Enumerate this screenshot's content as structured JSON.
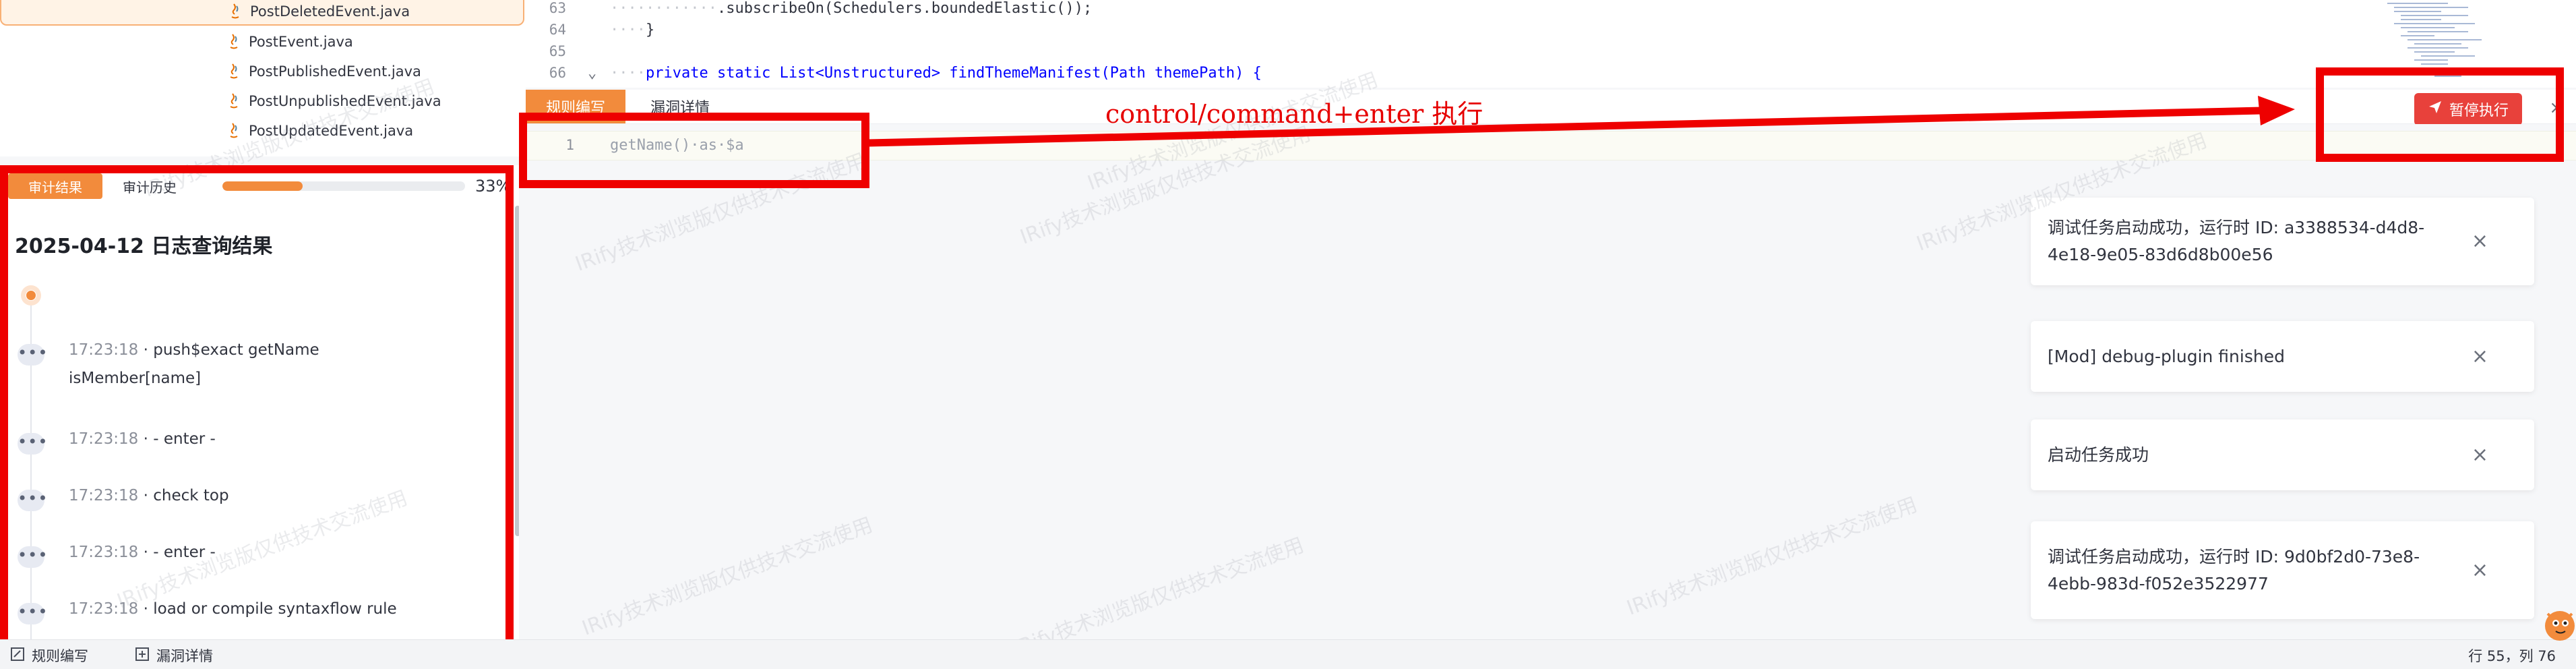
{
  "file_tree": {
    "items": [
      {
        "name": "PostDeletedEvent.java",
        "selected": true
      },
      {
        "name": "PostEvent.java",
        "selected": false
      },
      {
        "name": "PostPublishedEvent.java",
        "selected": false
      },
      {
        "name": "PostUnpublishedEvent.java",
        "selected": false
      },
      {
        "name": "PostUpdatedEvent.java",
        "selected": false
      }
    ]
  },
  "code_editor": {
    "lines": [
      {
        "no": "63",
        "ws": "············",
        "text": ".subscribeOn(Schedulers.boundedElastic());"
      },
      {
        "no": "64",
        "ws": "····",
        "text": "}"
      },
      {
        "no": "65",
        "ws": "",
        "text": ""
      },
      {
        "no": "66",
        "ws": "····",
        "text": "private static List<Unstructured> findThemeManifest(Path themePath) {"
      }
    ]
  },
  "rule_editor": {
    "tabs": [
      "规则编写",
      "漏洞详情"
    ],
    "line_no": "1",
    "rule_text": "getName()·as·$a",
    "pause_button": "暂停执行",
    "close_icon": "×"
  },
  "annotation": {
    "label": "control/command+enter 执行",
    "color": "#ee0000"
  },
  "audit_panel": {
    "tabs": [
      "审计结果",
      "审计历史"
    ],
    "progress": 0.33,
    "progress_label": "33%",
    "title": "2025-04-12 日志查询结果",
    "timeline": [
      {
        "time": "17:23:18",
        "message": "push$exact   getName isMember[name]"
      },
      {
        "time": "17:23:18",
        "message": "- enter -"
      },
      {
        "time": "17:23:18",
        "message": "check top"
      },
      {
        "time": "17:23:18",
        "message": "- enter -"
      },
      {
        "time": "17:23:18",
        "message": "load or compile syntaxflow rule"
      }
    ]
  },
  "notifications": [
    {
      "text": "调试任务启动成功，运行时 ID: a3388534-d4d8-4e18-9e05-83d6d8b00e56"
    },
    {
      "text": "[Mod] debug-plugin finished"
    },
    {
      "text": "启动任务成功"
    },
    {
      "text": "调试任务启动成功，运行时 ID: 9d0bf2d0-73e8-4ebb-983d-f052e3522977"
    }
  ],
  "watermark": "IRify技术浏览版仅供技术交流使用",
  "status_bar": {
    "items": [
      "规则编写",
      "漏洞详情"
    ],
    "cursor": "行 55，列 76"
  },
  "colors": {
    "accent": "#f28b3c",
    "danger": "#e8413b",
    "annotation": "#ee0000"
  }
}
